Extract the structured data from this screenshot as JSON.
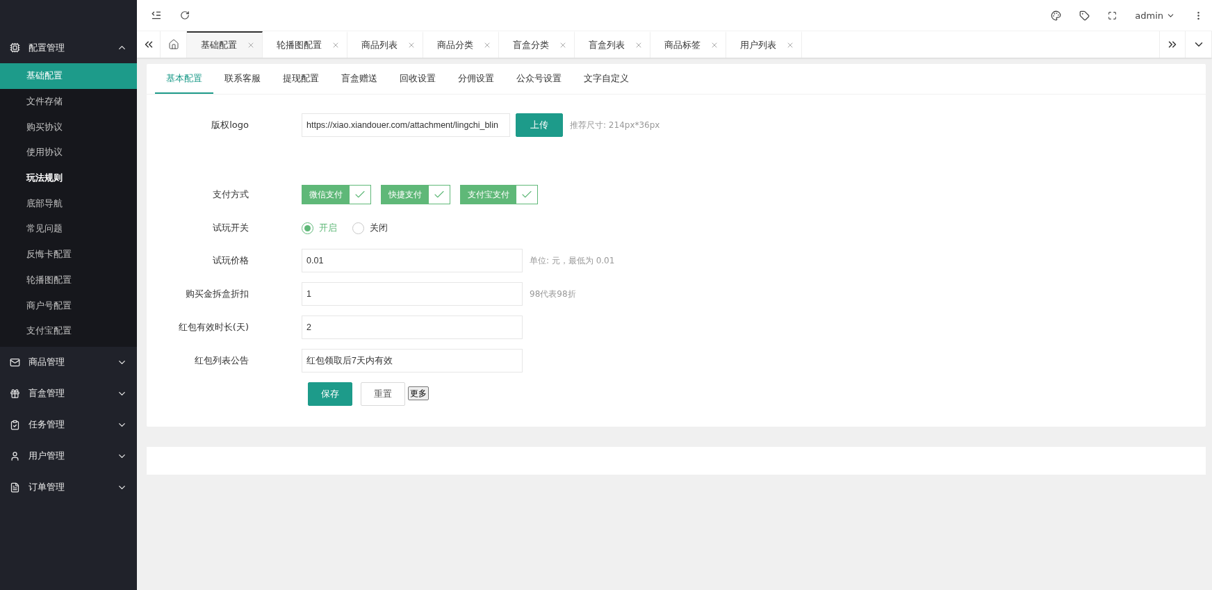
{
  "sidebar": {
    "groups": [
      {
        "label": "配置管理",
        "expanded": true,
        "items": [
          {
            "label": "基础配置",
            "selected": true,
            "hovered": false
          },
          {
            "label": "文件存储",
            "selected": false,
            "hovered": false
          },
          {
            "label": "购买协议",
            "selected": false,
            "hovered": false
          },
          {
            "label": "使用协议",
            "selected": false,
            "hovered": false
          },
          {
            "label": "玩法规则",
            "selected": false,
            "hovered": true
          },
          {
            "label": "底部导航",
            "selected": false,
            "hovered": false
          },
          {
            "label": "常见问题",
            "selected": false,
            "hovered": false
          },
          {
            "label": "反悔卡配置",
            "selected": false,
            "hovered": false
          },
          {
            "label": "轮播图配置",
            "selected": false,
            "hovered": false
          },
          {
            "label": "商户号配置",
            "selected": false,
            "hovered": false
          },
          {
            "label": "支付宝配置",
            "selected": false,
            "hovered": false
          }
        ]
      },
      {
        "label": "商品管理",
        "expanded": false
      },
      {
        "label": "盲盒管理",
        "expanded": false
      },
      {
        "label": "任务管理",
        "expanded": false
      },
      {
        "label": "用户管理",
        "expanded": false
      },
      {
        "label": "订单管理",
        "expanded": false
      }
    ]
  },
  "topbar": {
    "user": "admin"
  },
  "page_tabs": [
    {
      "label": "基础配置",
      "selected": true
    },
    {
      "label": "轮播图配置",
      "selected": false
    },
    {
      "label": "商品列表",
      "selected": false
    },
    {
      "label": "商品分类",
      "selected": false
    },
    {
      "label": "盲盒分类",
      "selected": false
    },
    {
      "label": "盲盒列表",
      "selected": false
    },
    {
      "label": "商品标签",
      "selected": false
    },
    {
      "label": "用户列表",
      "selected": false
    }
  ],
  "sub_tabs": [
    {
      "label": "基本配置",
      "selected": true
    },
    {
      "label": "联系客服",
      "selected": false
    },
    {
      "label": "提现配置",
      "selected": false
    },
    {
      "label": "盲盒赠送",
      "selected": false
    },
    {
      "label": "回收设置",
      "selected": false
    },
    {
      "label": "分佣设置",
      "selected": false
    },
    {
      "label": "公众号设置",
      "selected": false
    },
    {
      "label": "文字自定义",
      "selected": false
    }
  ],
  "form": {
    "logo": {
      "label": "版权logo",
      "value": "https://xiao.xiandouer.com/attachment/lingchi_blin",
      "button": "上传",
      "hint": "推荐尺寸: 214px*36px"
    },
    "payment": {
      "label": "支付方式",
      "options": [
        {
          "label": "微信支付",
          "checked": true
        },
        {
          "label": "快捷支付",
          "checked": true
        },
        {
          "label": "支付宝支付",
          "checked": true
        }
      ]
    },
    "trial": {
      "label": "试玩开关",
      "options": [
        {
          "label": "开启",
          "selected": true
        },
        {
          "label": "关闭",
          "selected": false
        }
      ]
    },
    "fields": [
      {
        "label": "试玩价格",
        "value": "0.01",
        "hint": "单位: 元，最低为 0.01"
      },
      {
        "label": "购买金拆盒折扣",
        "value": "1",
        "hint": "98代表98折"
      },
      {
        "label": "红包有效时长(天)",
        "value": "2"
      },
      {
        "label": "红包列表公告",
        "value": "红包领取后7天内有效"
      }
    ],
    "buttons": {
      "save": "保存",
      "reset": "重置",
      "more": "更多"
    }
  }
}
